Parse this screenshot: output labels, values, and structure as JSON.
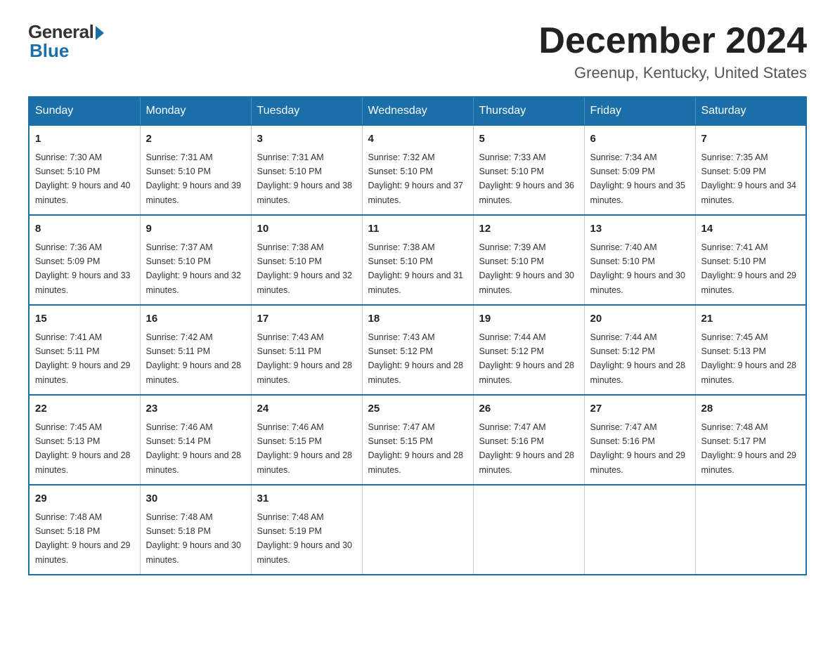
{
  "logo": {
    "general": "General",
    "blue": "Blue"
  },
  "title": "December 2024",
  "location": "Greenup, Kentucky, United States",
  "days_of_week": [
    "Sunday",
    "Monday",
    "Tuesday",
    "Wednesday",
    "Thursday",
    "Friday",
    "Saturday"
  ],
  "weeks": [
    [
      {
        "day": "1",
        "sunrise": "7:30 AM",
        "sunset": "5:10 PM",
        "daylight": "9 hours and 40 minutes."
      },
      {
        "day": "2",
        "sunrise": "7:31 AM",
        "sunset": "5:10 PM",
        "daylight": "9 hours and 39 minutes."
      },
      {
        "day": "3",
        "sunrise": "7:31 AM",
        "sunset": "5:10 PM",
        "daylight": "9 hours and 38 minutes."
      },
      {
        "day": "4",
        "sunrise": "7:32 AM",
        "sunset": "5:10 PM",
        "daylight": "9 hours and 37 minutes."
      },
      {
        "day": "5",
        "sunrise": "7:33 AM",
        "sunset": "5:10 PM",
        "daylight": "9 hours and 36 minutes."
      },
      {
        "day": "6",
        "sunrise": "7:34 AM",
        "sunset": "5:09 PM",
        "daylight": "9 hours and 35 minutes."
      },
      {
        "day": "7",
        "sunrise": "7:35 AM",
        "sunset": "5:09 PM",
        "daylight": "9 hours and 34 minutes."
      }
    ],
    [
      {
        "day": "8",
        "sunrise": "7:36 AM",
        "sunset": "5:09 PM",
        "daylight": "9 hours and 33 minutes."
      },
      {
        "day": "9",
        "sunrise": "7:37 AM",
        "sunset": "5:10 PM",
        "daylight": "9 hours and 32 minutes."
      },
      {
        "day": "10",
        "sunrise": "7:38 AM",
        "sunset": "5:10 PM",
        "daylight": "9 hours and 32 minutes."
      },
      {
        "day": "11",
        "sunrise": "7:38 AM",
        "sunset": "5:10 PM",
        "daylight": "9 hours and 31 minutes."
      },
      {
        "day": "12",
        "sunrise": "7:39 AM",
        "sunset": "5:10 PM",
        "daylight": "9 hours and 30 minutes."
      },
      {
        "day": "13",
        "sunrise": "7:40 AM",
        "sunset": "5:10 PM",
        "daylight": "9 hours and 30 minutes."
      },
      {
        "day": "14",
        "sunrise": "7:41 AM",
        "sunset": "5:10 PM",
        "daylight": "9 hours and 29 minutes."
      }
    ],
    [
      {
        "day": "15",
        "sunrise": "7:41 AM",
        "sunset": "5:11 PM",
        "daylight": "9 hours and 29 minutes."
      },
      {
        "day": "16",
        "sunrise": "7:42 AM",
        "sunset": "5:11 PM",
        "daylight": "9 hours and 28 minutes."
      },
      {
        "day": "17",
        "sunrise": "7:43 AM",
        "sunset": "5:11 PM",
        "daylight": "9 hours and 28 minutes."
      },
      {
        "day": "18",
        "sunrise": "7:43 AM",
        "sunset": "5:12 PM",
        "daylight": "9 hours and 28 minutes."
      },
      {
        "day": "19",
        "sunrise": "7:44 AM",
        "sunset": "5:12 PM",
        "daylight": "9 hours and 28 minutes."
      },
      {
        "day": "20",
        "sunrise": "7:44 AM",
        "sunset": "5:12 PM",
        "daylight": "9 hours and 28 minutes."
      },
      {
        "day": "21",
        "sunrise": "7:45 AM",
        "sunset": "5:13 PM",
        "daylight": "9 hours and 28 minutes."
      }
    ],
    [
      {
        "day": "22",
        "sunrise": "7:45 AM",
        "sunset": "5:13 PM",
        "daylight": "9 hours and 28 minutes."
      },
      {
        "day": "23",
        "sunrise": "7:46 AM",
        "sunset": "5:14 PM",
        "daylight": "9 hours and 28 minutes."
      },
      {
        "day": "24",
        "sunrise": "7:46 AM",
        "sunset": "5:15 PM",
        "daylight": "9 hours and 28 minutes."
      },
      {
        "day": "25",
        "sunrise": "7:47 AM",
        "sunset": "5:15 PM",
        "daylight": "9 hours and 28 minutes."
      },
      {
        "day": "26",
        "sunrise": "7:47 AM",
        "sunset": "5:16 PM",
        "daylight": "9 hours and 28 minutes."
      },
      {
        "day": "27",
        "sunrise": "7:47 AM",
        "sunset": "5:16 PM",
        "daylight": "9 hours and 29 minutes."
      },
      {
        "day": "28",
        "sunrise": "7:48 AM",
        "sunset": "5:17 PM",
        "daylight": "9 hours and 29 minutes."
      }
    ],
    [
      {
        "day": "29",
        "sunrise": "7:48 AM",
        "sunset": "5:18 PM",
        "daylight": "9 hours and 29 minutes."
      },
      {
        "day": "30",
        "sunrise": "7:48 AM",
        "sunset": "5:18 PM",
        "daylight": "9 hours and 30 minutes."
      },
      {
        "day": "31",
        "sunrise": "7:48 AM",
        "sunset": "5:19 PM",
        "daylight": "9 hours and 30 minutes."
      },
      null,
      null,
      null,
      null
    ]
  ]
}
